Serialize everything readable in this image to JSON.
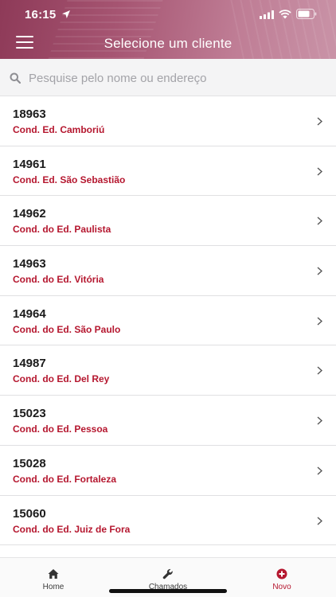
{
  "status_bar": {
    "time": "16:15"
  },
  "header": {
    "title": "Selecione um cliente",
    "menu_icon": "hamburger-menu-icon"
  },
  "search": {
    "placeholder": "Pesquise pelo nome ou endereço",
    "value": ""
  },
  "clients": [
    {
      "code": "18963",
      "name": "Cond. Ed. Camboriú"
    },
    {
      "code": "14961",
      "name": "Cond. Ed. São Sebastião"
    },
    {
      "code": "14962",
      "name": "Cond. do Ed. Paulista"
    },
    {
      "code": "14963",
      "name": "Cond. do Ed. Vitória"
    },
    {
      "code": "14964",
      "name": "Cond. do Ed. São Paulo"
    },
    {
      "code": "14987",
      "name": "Cond. do Ed. Del Rey"
    },
    {
      "code": "15023",
      "name": "Cond. do Ed. Pessoa"
    },
    {
      "code": "15028",
      "name": "Cond. do Ed. Fortaleza"
    },
    {
      "code": "15060",
      "name": "Cond. do Ed. Juiz de Fora"
    }
  ],
  "tabs": [
    {
      "label": "Home",
      "icon": "home-icon"
    },
    {
      "label": "Chamados",
      "icon": "wrench-icon"
    },
    {
      "label": "Novo",
      "icon": "plus-circle-icon",
      "active": true
    }
  ],
  "colors": {
    "accent": "#b5172f",
    "header": "#a65572"
  }
}
